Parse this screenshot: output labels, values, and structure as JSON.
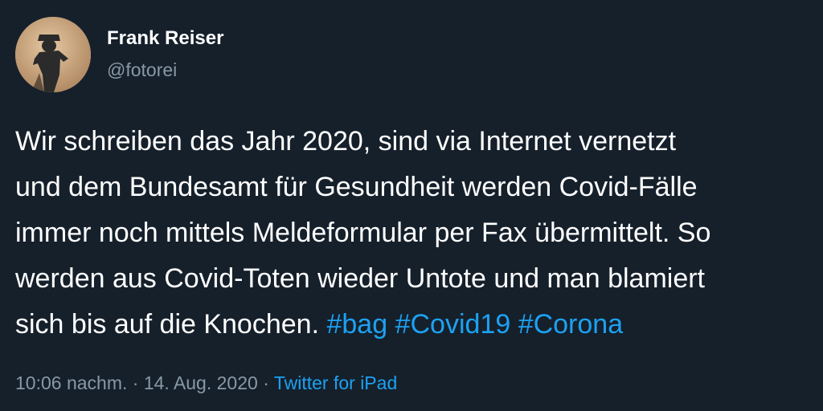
{
  "author": {
    "display_name": "Frank Reiser",
    "handle": "@fotorei"
  },
  "tweet": {
    "lines": [
      "Wir schreiben das Jahr 2020, sind via Internet vernetzt",
      "und dem  Bundesamt für Gesundheit werden Covid-Fälle",
      "immer noch mittels Meldeformular per Fax übermittelt. So",
      "werden aus Covid-Toten wieder Untote und man blamiert",
      "sich bis auf die Knochen."
    ],
    "hashtags": [
      "#bag",
      "#Covid19",
      "#Corona"
    ]
  },
  "meta": {
    "time": "10:06 nachm.",
    "separator": "·",
    "date": "14. Aug. 2020",
    "source": "Twitter for iPad"
  },
  "colors": {
    "background": "#15202b",
    "text": "#ffffff",
    "secondary": "#8899a6",
    "accent": "#1da1f2"
  },
  "icons": {
    "avatar": "profile-photo-silhouette"
  }
}
